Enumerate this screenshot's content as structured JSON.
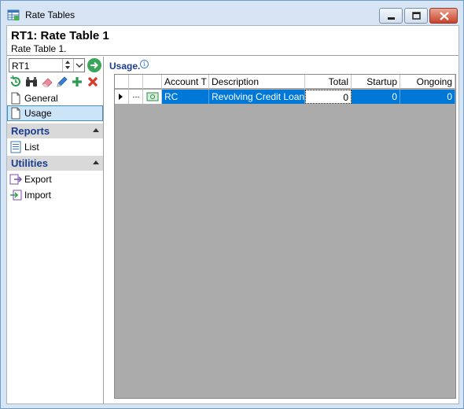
{
  "window": {
    "title": "Rate Tables",
    "accent_color": "#0078d7"
  },
  "header": {
    "title": "RT1: Rate Table 1",
    "subtitle": "Rate Table 1."
  },
  "selector": {
    "value": "RT1"
  },
  "toolbar": {
    "icons": [
      "history-icon",
      "binoculars-icon",
      "eraser-icon",
      "pencil-icon",
      "add-icon",
      "delete-icon"
    ]
  },
  "nav": {
    "general_label": "General",
    "usage_label": "Usage",
    "reports_label": "Reports",
    "list_label": "List",
    "utilities_label": "Utilities",
    "export_label": "Export",
    "import_label": "Import"
  },
  "usage": {
    "title": "Usage.",
    "columns": [
      "Account T",
      "Description",
      "Total",
      "Startup",
      "Ongoing"
    ],
    "rows": [
      {
        "ellipsis": "...",
        "account_type": "RC",
        "description": "Revolving Credit Loan",
        "total": "0",
        "startup": "0",
        "ongoing": "0"
      }
    ]
  }
}
